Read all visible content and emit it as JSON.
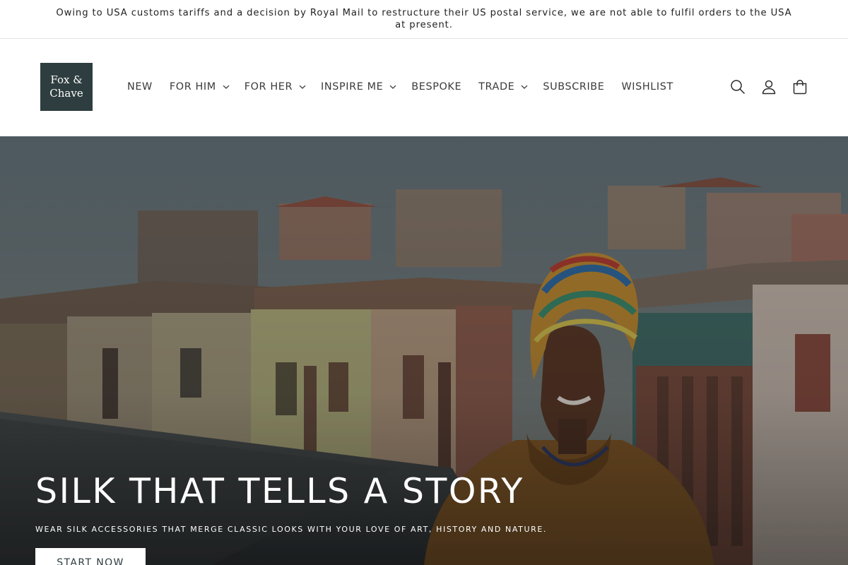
{
  "announcement": {
    "text": "Owing to USA customs tariffs and a decision by Royal Mail to restructure their US postal service, we are not able to fulfil orders to the USA at present."
  },
  "header": {
    "logo": {
      "line1": "Fox &",
      "line2": "Chave",
      "bg_color": "#2e3d3f"
    },
    "nav": [
      {
        "label": "NEW",
        "dropdown": false
      },
      {
        "label": "FOR HIM",
        "dropdown": true
      },
      {
        "label": "FOR HER",
        "dropdown": true
      },
      {
        "label": "INSPIRE ME",
        "dropdown": true
      },
      {
        "label": "BESPOKE",
        "dropdown": false
      },
      {
        "label": "TRADE",
        "dropdown": true
      },
      {
        "label": "SUBSCRIBE",
        "dropdown": false
      },
      {
        "label": "WISHLIST",
        "dropdown": false
      }
    ],
    "icons": [
      "search-icon",
      "account-icon",
      "cart-icon"
    ]
  },
  "hero": {
    "title": "SILK THAT TELLS A STORY",
    "subtitle": "WEAR SILK ACCESSORIES THAT MERGE CLASSIC LOOKS WITH YOUR LOVE OF ART, HISTORY AND NATURE.",
    "button_label": "START NOW",
    "button_color": "#ffffff"
  }
}
